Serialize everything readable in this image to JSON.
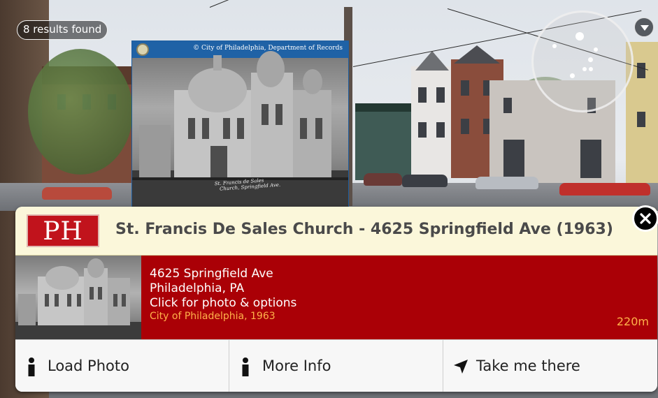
{
  "results": {
    "label": "8 results found"
  },
  "historical_photo": {
    "credit": "© City of Philadelphia, Department of Records",
    "caption": "St. Francis de Sales\n   Church, Springfield Ave."
  },
  "panel": {
    "logo_text": "PH",
    "title": "St. Francis De Sales Church - 4625 Springfield Ave (1963)",
    "address_line1": "4625 Springfield Ave",
    "address_line2": "Philadelphia, PA",
    "hint": "Click for photo & options",
    "source": "City of Philadelphia, 1963",
    "distance": "220m"
  },
  "actions": [
    {
      "label": "Load Photo",
      "icon": "info-icon"
    },
    {
      "label": "More Info",
      "icon": "info-icon"
    },
    {
      "label": "Take me there",
      "icon": "navigation-arrow-icon"
    }
  ],
  "colors": {
    "panel_red": "#aa0006",
    "header_cream": "#fbf7da",
    "accent_orange": "#ffb24a",
    "photo_blue": "#1f62a6"
  }
}
